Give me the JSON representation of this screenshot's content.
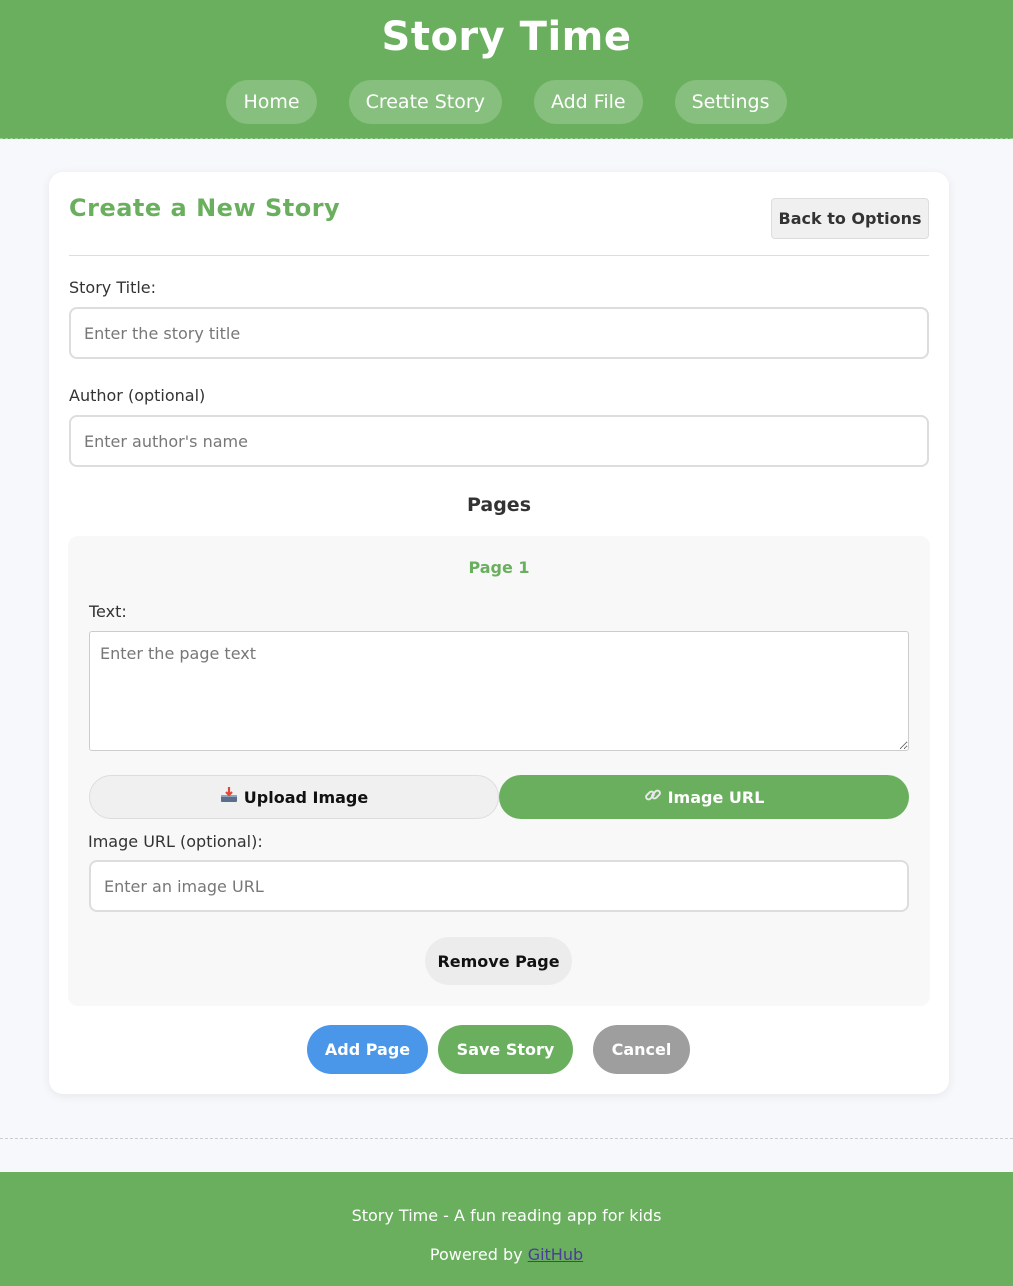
{
  "header": {
    "title": "Story Time",
    "nav": [
      {
        "label": "Home"
      },
      {
        "label": "Create Story"
      },
      {
        "label": "Add File"
      },
      {
        "label": "Settings"
      }
    ]
  },
  "form": {
    "heading": "Create a New Story",
    "back_label": "Back to Options",
    "title_label": "Story Title:",
    "title_placeholder": "Enter the story title",
    "author_label": "Author (optional)",
    "author_placeholder": "Enter author's name",
    "pages_heading": "Pages",
    "page": {
      "title": "Page 1",
      "text_label": "Text:",
      "text_placeholder": "Enter the page text",
      "upload_label": "Upload Image",
      "upload_icon": "inbox-tray-icon",
      "url_label": "Image URL",
      "url_icon": "link-icon",
      "image_url_label": "Image URL (optional):",
      "image_url_placeholder": "Enter an image URL",
      "remove_label": "Remove Page"
    },
    "add_page_label": "Add Page",
    "save_label": "Save Story",
    "cancel_label": "Cancel"
  },
  "footer": {
    "tagline": "Story Time - A fun reading app for kids",
    "powered_prefix": "Powered by",
    "powered_link": "GitHub"
  },
  "colors": {
    "brand_green": "#6aaf5e",
    "add_blue": "#4a97ea",
    "cancel_gray": "#9e9e9e"
  }
}
